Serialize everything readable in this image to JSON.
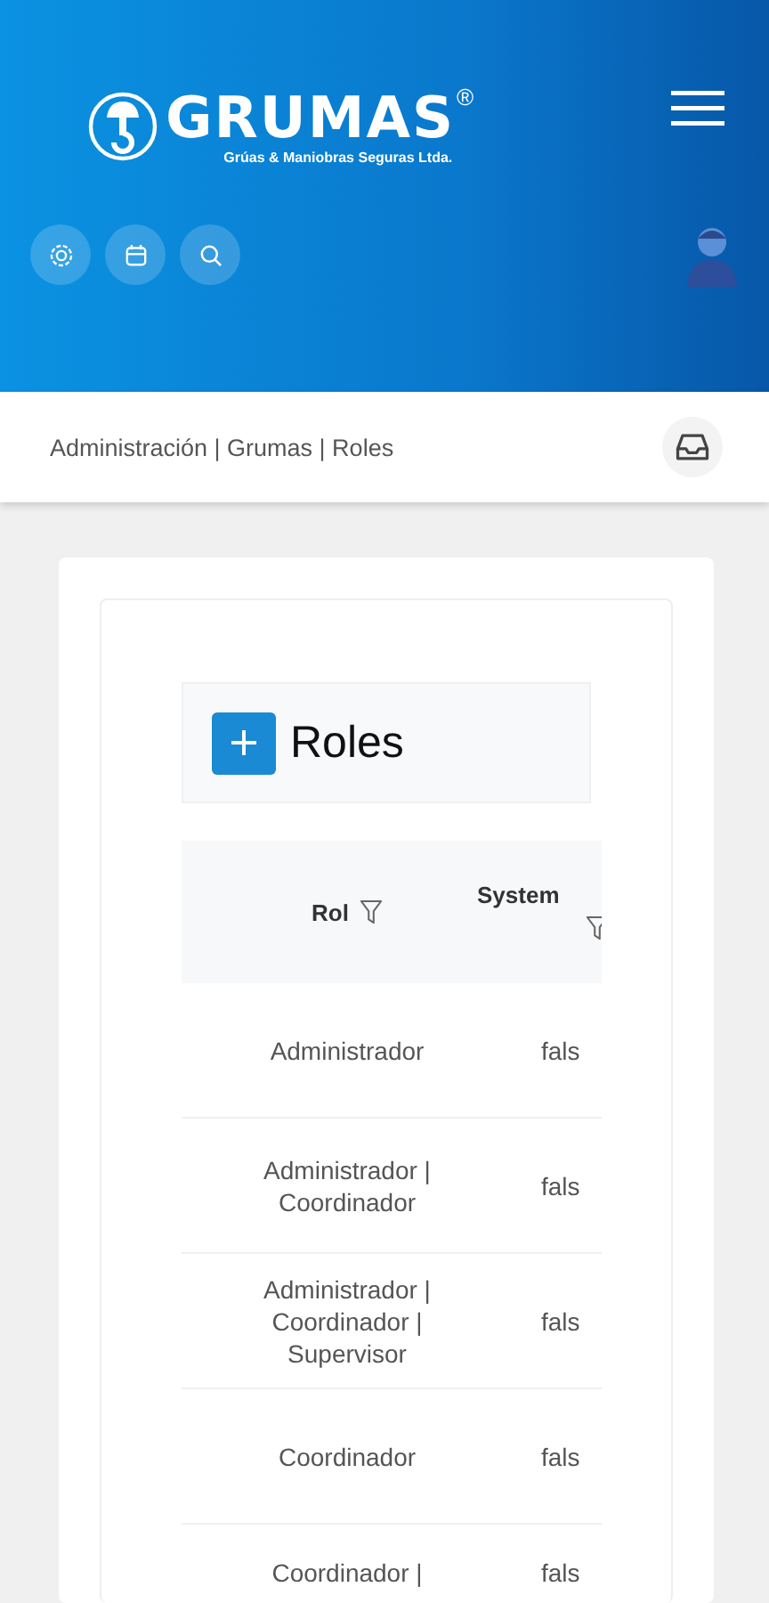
{
  "header": {
    "logo": {
      "name": "GRUMAS",
      "registered": "®",
      "tagline": "Grúas & Maniobras Seguras Ltda."
    },
    "tools": [
      {
        "kind": "settings"
      },
      {
        "kind": "calendar"
      },
      {
        "kind": "search"
      }
    ]
  },
  "breadcrumb": "Administración | Grumas | Roles",
  "panel": {
    "title": "Roles",
    "table": {
      "columns": [
        {
          "label": "Rol"
        },
        {
          "label": "System"
        }
      ],
      "rows": [
        {
          "cells": [
            "Administrador",
            "fals"
          ]
        },
        {
          "cells": [
            "Administrador | Coordinador",
            "fals"
          ]
        },
        {
          "cells": [
            "Administrador | Coordinador | Supervisor",
            "fals"
          ]
        },
        {
          "cells": [
            "Coordinador",
            "fals"
          ]
        },
        {
          "cells": [
            "Coordinador |",
            "fals"
          ]
        }
      ]
    }
  }
}
